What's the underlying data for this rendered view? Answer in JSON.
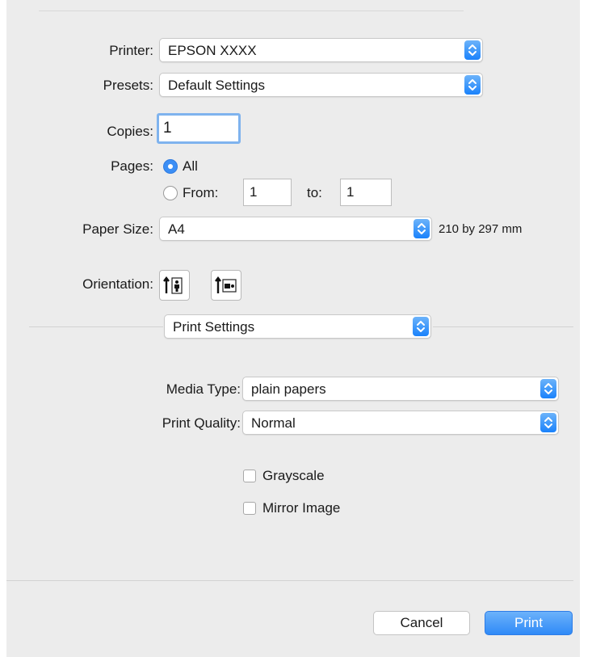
{
  "printer": {
    "label": "Printer:",
    "value": "EPSON XXXX"
  },
  "presets": {
    "label": "Presets:",
    "value": "Default Settings"
  },
  "copies": {
    "label": "Copies:",
    "value": "1"
  },
  "pages": {
    "label": "Pages:",
    "all_label": "All",
    "from_label": "From:",
    "from_value": "1",
    "to_label": "to:",
    "to_value": "1",
    "selected": "All"
  },
  "paper_size": {
    "label": "Paper Size:",
    "value": "A4",
    "dimensions": "210 by 297 mm"
  },
  "orientation": {
    "label": "Orientation:",
    "options": [
      "portrait",
      "landscape"
    ],
    "selected": "portrait"
  },
  "panel_selector": {
    "value": "Print Settings"
  },
  "media_type": {
    "label": "Media Type:",
    "value": "plain papers"
  },
  "print_quality": {
    "label": "Print Quality:",
    "value": "Normal"
  },
  "grayscale": {
    "label": "Grayscale",
    "checked": false
  },
  "mirror_image": {
    "label": "Mirror Image",
    "checked": false
  },
  "buttons": {
    "cancel": "Cancel",
    "print": "Print"
  },
  "colors": {
    "accent": "#3b8ef5",
    "background": "#ececec"
  }
}
